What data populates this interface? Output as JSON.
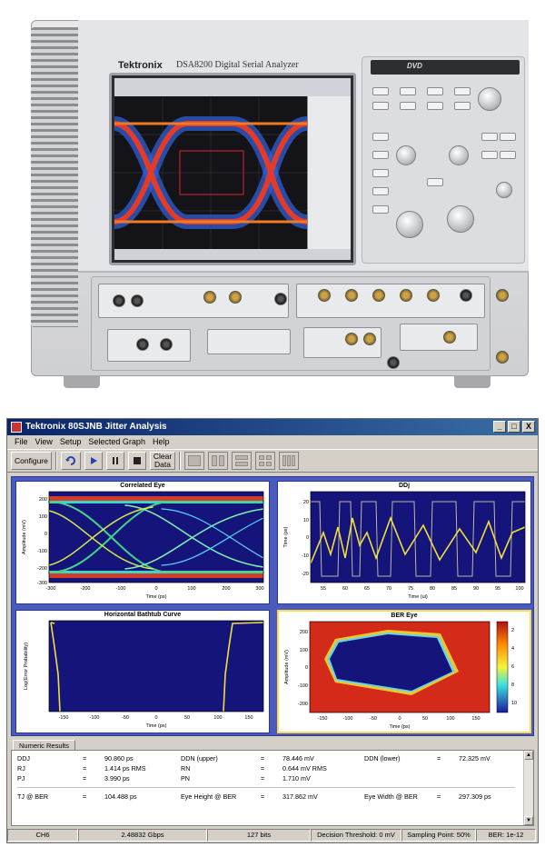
{
  "instrument": {
    "brand": "Tektronix",
    "model": "DSA8200 Digital Serial Analyzer",
    "dvd_label": "DVD"
  },
  "window": {
    "title": "Tektronix 80SJNB Jitter Analysis",
    "minimize": "_",
    "maximize": "□",
    "close": "X"
  },
  "menu": [
    "File",
    "View",
    "Setup",
    "Selected Graph",
    "Help"
  ],
  "toolbar": {
    "configure_label": "Configure",
    "clear_data_line1": "Clear",
    "clear_data_line2": "Data",
    "icons": [
      "refresh-icon",
      "run-icon",
      "step-icon",
      "stop-icon"
    ]
  },
  "graphs": {
    "correlated_eye": {
      "title": "Correlated Eye",
      "ylabel": "Amplitude (mV)",
      "xlabel": "Time (ps)",
      "yticks": [
        "200",
        "100",
        "0",
        "-100",
        "-200",
        "-300"
      ],
      "xticks": [
        "-300",
        "-200",
        "-100",
        "0",
        "100",
        "200",
        "300"
      ]
    },
    "ddj": {
      "title": "DDj",
      "ylabel": "Time (ps)",
      "xlabel": "Time (ui)",
      "yticks": [
        "20",
        "10",
        "0",
        "-10",
        "-20"
      ],
      "xticks": [
        "55",
        "60",
        "65",
        "70",
        "75",
        "80",
        "85",
        "90",
        "95",
        "100"
      ]
    },
    "bathtub": {
      "title": "Horizontal Bathtub Curve",
      "ylabel": "Log(Error Probability)",
      "xlabel": "Time (ps)",
      "xticks": [
        "-150",
        "-100",
        "-50",
        "0",
        "50",
        "100",
        "150"
      ]
    },
    "ber_eye": {
      "title": "BER Eye",
      "ylabel": "Amplitude (mV)",
      "xlabel": "Time (ps)",
      "yticks": [
        "200",
        "100",
        "0",
        "-100",
        "-200"
      ],
      "xticks": [
        "-150",
        "-100",
        "-50",
        "0",
        "50",
        "100",
        "150"
      ],
      "colorbar_ticks": [
        "2",
        "4",
        "6",
        "8",
        "10"
      ]
    }
  },
  "results": {
    "tab_label": "Numeric Results",
    "rows": [
      [
        {
          "k": "DDJ",
          "v": "90.860 ps"
        },
        {
          "k": "DDN (upper)",
          "v": "78.446 mV"
        },
        {
          "k": "DDN (lower)",
          "v": "72.325 mV"
        }
      ],
      [
        {
          "k": "RJ",
          "v": "1.414 ps RMS"
        },
        {
          "k": "RN",
          "v": "0.644 mV RMS"
        },
        {
          "k": "",
          "v": ""
        }
      ],
      [
        {
          "k": "PJ",
          "v": "3.990 ps"
        },
        {
          "k": "PN",
          "v": "1.710 mV"
        },
        {
          "k": "",
          "v": ""
        }
      ],
      [
        {
          "k": "TJ @ BER",
          "v": "104.488 ps"
        },
        {
          "k": "Eye Height @ BER",
          "v": "317.862 mV"
        },
        {
          "k": "Eye Width @ BER",
          "v": "297.309 ps"
        }
      ]
    ]
  },
  "status": {
    "channel": "CH6",
    "rate": "2.48832 Gbps",
    "bits": "127 bits",
    "threshold": "Decision Threshold: 0 mV",
    "sampling": "Sampling Point: 50%",
    "ber": "BER: 1e-12"
  }
}
